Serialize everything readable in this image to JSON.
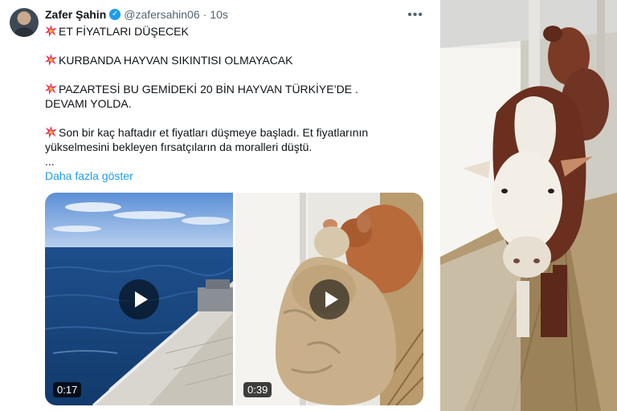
{
  "tweet": {
    "author_name": "Zafer Şahin",
    "handle": "@zafersahin06",
    "separator": "·",
    "time": "10s",
    "more_label": "•••",
    "paragraphs": [
      "ET FİYATLARI DÜŞECEK",
      "KURBANDA HAYVAN SIKINTISI OLMAYACAK",
      "PAZARTESİ BU GEMİDEKİ 20 BİN HAYVAN TÜRKİYE’DE . DEVAMI YOLDA.",
      "Son bir kaç haftadır et fiyatları düşmeye başladı. Et fiyatlarının yükselmesini bekleyen fırsatçıların da moralleri düştü."
    ],
    "ellipsis": "...",
    "show_more": "Daha fazla göster",
    "videos": [
      {
        "duration": "0:17"
      },
      {
        "duration": "0:39"
      }
    ],
    "icons": [
      "verified-badge-icon",
      "anger-burst-icon",
      "play-icon",
      "more-icon"
    ],
    "colors": {
      "link": "#1d9bf0",
      "text": "#0f1419",
      "muted": "#536471"
    }
  }
}
